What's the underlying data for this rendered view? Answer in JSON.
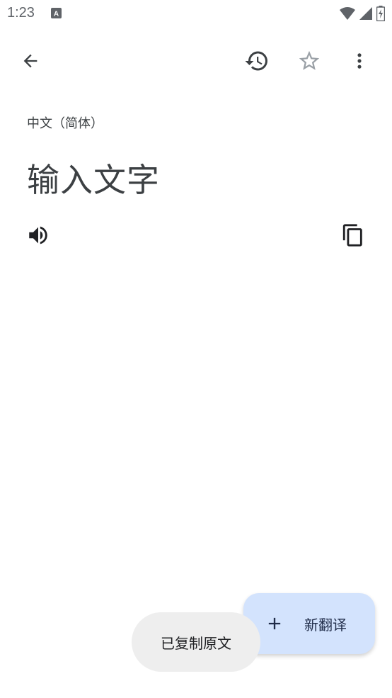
{
  "status_bar": {
    "time": "1:23",
    "notification_icon": "text-a-icon",
    "icons": [
      "wifi-icon",
      "signal-icon",
      "battery-charging-icon"
    ]
  },
  "toolbar": {
    "back_icon": "arrow-back-icon",
    "history_icon": "history-icon",
    "favorite_icon": "star-outline-icon",
    "more_icon": "more-vert-icon"
  },
  "content": {
    "language": "中文（简体）",
    "text": "输入文字"
  },
  "actions": {
    "speak_icon": "volume-up-icon",
    "copy_icon": "copy-icon"
  },
  "fab": {
    "label": "新翻译",
    "icon": "plus-icon"
  },
  "toast": {
    "text": "已复制原文"
  },
  "colors": {
    "fab_background": "#d3e3fd",
    "toast_background": "#eeeeee",
    "icon_color": "#3c4043"
  }
}
